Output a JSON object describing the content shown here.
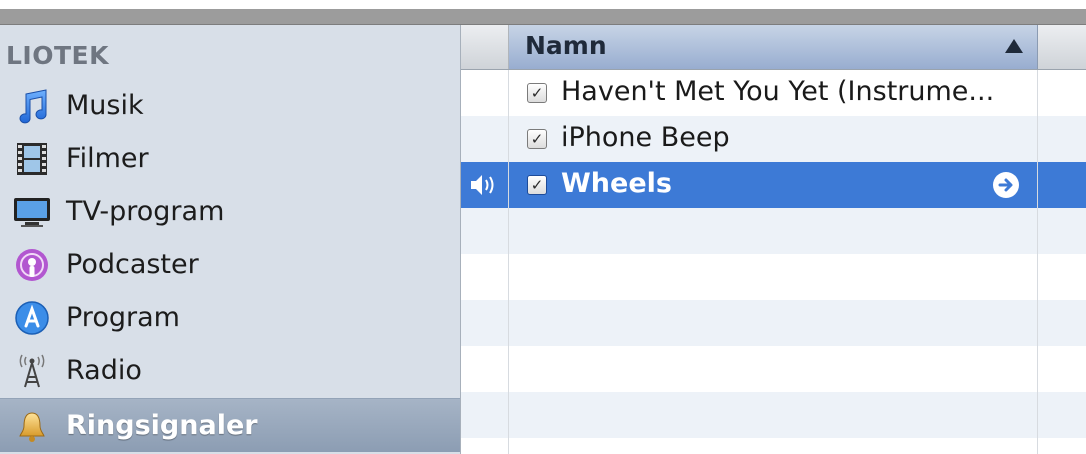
{
  "sidebar": {
    "section_header": "LIOTEK",
    "items": [
      {
        "label": "Musik",
        "icon": "music-note-icon"
      },
      {
        "label": "Filmer",
        "icon": "film-icon"
      },
      {
        "label": "TV-program",
        "icon": "tv-icon"
      },
      {
        "label": "Podcaster",
        "icon": "podcast-icon"
      },
      {
        "label": "Program",
        "icon": "app-store-icon"
      },
      {
        "label": "Radio",
        "icon": "radio-antenna-icon"
      },
      {
        "label": "Ringsignaler",
        "icon": "bell-icon",
        "selected": true
      }
    ]
  },
  "list": {
    "column_name": "Namn",
    "sort": "ascending",
    "rows": [
      {
        "title": "Haven't Met You Yet (Instrume...",
        "checked": true
      },
      {
        "title": "iPhone Beep",
        "checked": true
      },
      {
        "title": "Wheels",
        "checked": true,
        "selected": true,
        "playing": true
      }
    ]
  },
  "colors": {
    "sidebar_bg": "#d8dfe8",
    "selection_blue": "#3d7ad6",
    "sidebar_selected": "#94a4b9",
    "stripe": "#edf2f8"
  }
}
